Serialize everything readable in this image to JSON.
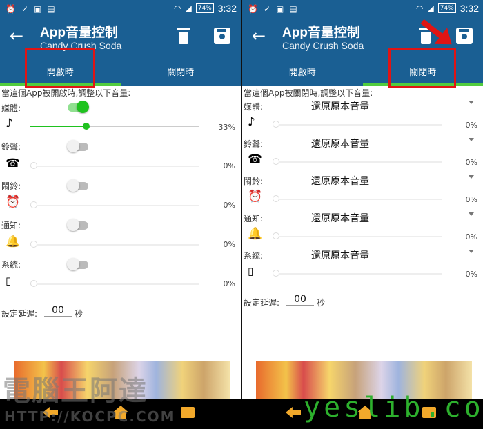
{
  "status": {
    "battery": "74%",
    "time": "3:32"
  },
  "app": {
    "title": "App音量控制",
    "subtitle": "Candy Crush Soda"
  },
  "tabs": {
    "open": "開啟時",
    "close": "關閉時"
  },
  "content": {
    "open_prompt": "當這個App被開啟時,調整以下音量:",
    "close_prompt": "當這個App被關閉時,調整以下音量:",
    "delay_label": "設定延遲:",
    "delay_value": "00",
    "delay_unit": "秒"
  },
  "open_rows": [
    {
      "label": "媒體:",
      "icon": "music-note-icon",
      "enabled": true,
      "volume_pct": 33,
      "percent_text": "33%"
    },
    {
      "label": "鈴聲:",
      "icon": "phone-ringing-icon",
      "enabled": false,
      "volume_pct": 0,
      "percent_text": "0%"
    },
    {
      "label": "鬧鈴:",
      "icon": "alarm-clock-icon",
      "enabled": false,
      "volume_pct": 0,
      "percent_text": "0%"
    },
    {
      "label": "通知:",
      "icon": "bell-icon",
      "enabled": false,
      "volume_pct": 0,
      "percent_text": "0%"
    },
    {
      "label": "系統:",
      "icon": "phone-icon",
      "enabled": false,
      "volume_pct": 0,
      "percent_text": "0%"
    }
  ],
  "close_rows": [
    {
      "label": "媒體:",
      "option": "還原原本音量",
      "percent_text": "0%"
    },
    {
      "label": "鈴聲:",
      "option": "還原原本音量",
      "percent_text": "0%"
    },
    {
      "label": "鬧鈴:",
      "option": "還原原本音量",
      "percent_text": "0%"
    },
    {
      "label": "通知:",
      "option": "還原原本音量",
      "percent_text": "0%"
    },
    {
      "label": "系統:",
      "option": "還原原本音量",
      "percent_text": "0%"
    }
  ],
  "watermarks": {
    "left_top": "電腦王阿達",
    "left_bottom": "HTTP://KOCPC.COM",
    "right": "yeslib.com"
  },
  "colors": {
    "appbar": "#1a5f93",
    "accent": "#1fc21f",
    "highlight": "#e01414",
    "nav": "#f2a92b"
  }
}
